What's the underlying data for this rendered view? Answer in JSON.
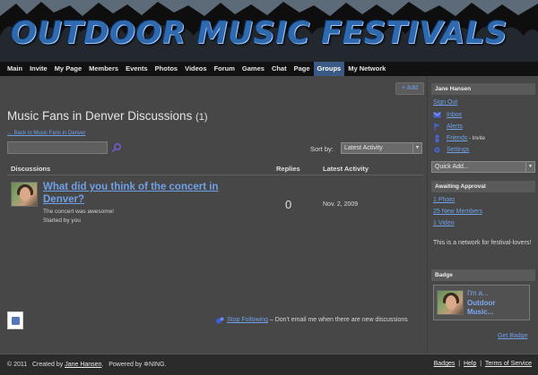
{
  "site": {
    "title": "OUTDOOR MUSIC FESTIVALS"
  },
  "nav": {
    "items": [
      {
        "label": "Main",
        "active": false
      },
      {
        "label": "Invite",
        "active": false
      },
      {
        "label": "My Page",
        "active": false
      },
      {
        "label": "Members",
        "active": false
      },
      {
        "label": "Events",
        "active": false
      },
      {
        "label": "Photos",
        "active": false
      },
      {
        "label": "Videos",
        "active": false
      },
      {
        "label": "Forum",
        "active": false
      },
      {
        "label": "Games",
        "active": false
      },
      {
        "label": "Chat",
        "active": false
      },
      {
        "label": "Page",
        "active": false
      },
      {
        "label": "Groups",
        "active": true
      },
      {
        "label": "My Network",
        "active": false
      }
    ]
  },
  "main": {
    "add_label": "+ Add",
    "title": "Music Fans in Denver Discussions",
    "count": "(1)",
    "back_link": "← Back to Music Fans in Denver",
    "search_value": "",
    "sort_label": "Sort by:",
    "sort_value": "Latest Activity",
    "columns": {
      "discussions": "Discussions",
      "replies": "Replies",
      "latest": "Latest Activity"
    },
    "topics": [
      {
        "title": "What did you think of the concert in Denver?",
        "excerpt": "The concert was awesome!",
        "author": "Started by you",
        "replies": "0",
        "latest_activity": "Nov. 2, 2009"
      }
    ],
    "follow": {
      "link": "Stop Following",
      "text": "– Don't email me when there are new discussions"
    }
  },
  "sidebar": {
    "user": {
      "name": "Jane Hansen",
      "sign_out": "Sign Out",
      "links": [
        {
          "label": "Inbox",
          "icon": "envelope-icon"
        },
        {
          "label": "Alerts",
          "icon": "flag-icon"
        },
        {
          "label": "Friends",
          "icon": "person-icon",
          "suffix": " - Invite"
        },
        {
          "label": "Settings",
          "icon": "gear-icon"
        }
      ]
    },
    "quick_add": "Quick Add...",
    "approval": {
      "heading": "Awaiting Approval",
      "items": [
        "1 Photo",
        "25 New Members",
        "1 Video"
      ]
    },
    "network_note": "This is a network for festival-lovers!",
    "badge": {
      "heading": "Badge",
      "text_lines": [
        "I'm a...",
        "Outdoor",
        "Music..."
      ],
      "get_badge": "Get Badge"
    }
  },
  "footer": {
    "copyright": "© 2011",
    "created_by_label": "Created by",
    "creator": "Jane Hansen",
    "powered_label": "Powered by",
    "powered_name": "NING.",
    "links": [
      "Badges",
      "Help",
      "Terms of Service"
    ]
  },
  "colors": {
    "nav_active": "#3b5a86",
    "link": "#6fa0e8",
    "title_blue": "#2f6aae"
  }
}
